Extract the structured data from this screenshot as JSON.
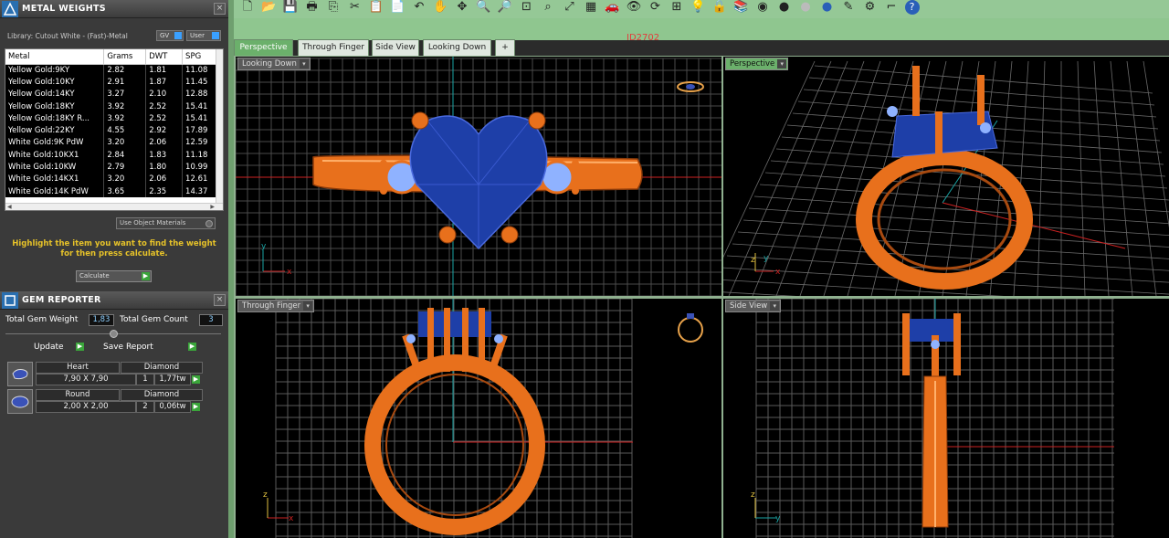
{
  "metal_weights": {
    "title": "METAL WEIGHTS",
    "close": "×",
    "library": "Library: Cutout White - (Fast)-Metal",
    "gv_btn": "GV",
    "user_btn": "User",
    "columns": [
      "Metal",
      "Grams",
      "DWT",
      "SPG"
    ],
    "rows": [
      [
        "Yellow Gold:9KY",
        "2.82",
        "1.81",
        "11.08"
      ],
      [
        "Yellow Gold:10KY",
        "2.91",
        "1.87",
        "11.45"
      ],
      [
        "Yellow Gold:14KY",
        "3.27",
        "2.10",
        "12.88"
      ],
      [
        "Yellow Gold:18KY",
        "3.92",
        "2.52",
        "15.41"
      ],
      [
        "Yellow Gold:18KY R...",
        "3.92",
        "2.52",
        "15.41"
      ],
      [
        "Yellow Gold:22KY",
        "4.55",
        "2.92",
        "17.89"
      ],
      [
        "White Gold:9K PdW",
        "3.20",
        "2.06",
        "12.59"
      ],
      [
        "White Gold:10KX1",
        "2.84",
        "1.83",
        "11.18"
      ],
      [
        "White Gold:10KW",
        "2.79",
        "1.80",
        "10.99"
      ],
      [
        "White Gold:14KX1",
        "3.20",
        "2.06",
        "12.61"
      ],
      [
        "White Gold:14K PdW",
        "3.65",
        "2.35",
        "14.37"
      ]
    ],
    "use_object_materials": "Use Object Materials",
    "highlight_text_1": "Highlight the item you want to find the weight",
    "highlight_text_2": "for then press calculate.",
    "calculate": "Calculate"
  },
  "gem_reporter": {
    "title": "GEM REPORTER",
    "close": "×",
    "total_weight_label": "Total Gem Weight",
    "total_weight_value": "1,83",
    "total_count_label": "Total Gem Count",
    "total_count_value": "3",
    "update": "Update",
    "save_report": "Save Report",
    "gems": [
      {
        "shape": "Heart",
        "size": "7,90 X 7,90",
        "material": "Diamond",
        "count": "1",
        "weight": "1,77tw"
      },
      {
        "shape": "Round",
        "size": "2,00 X 2,00",
        "material": "Diamond",
        "count": "2",
        "weight": "0,06tw"
      }
    ]
  },
  "document_id": "ID2702",
  "tabs": [
    "Perspective",
    "Through Finger",
    "Side View",
    "Looking Down",
    "+"
  ],
  "active_tab": 0,
  "viewports": {
    "top_left": {
      "label": "Looking Down",
      "axis_v": "y",
      "axis_h": "x"
    },
    "top_right": {
      "label": "Perspective",
      "axis_v": "z",
      "axis_h": "x",
      "axis_d": "y"
    },
    "bottom_left": {
      "label": "Through Finger",
      "axis_v": "z",
      "axis_h": "x"
    },
    "bottom_right": {
      "label": "Side View",
      "axis_v": "z",
      "axis_h": "y"
    }
  },
  "colors": {
    "metal": "#e8701c",
    "gem": "#1e3fa8",
    "accent_label": "#e6c229",
    "grid": "#7a7a7a",
    "axis_x": "#cc2222",
    "axis_y": "#1aa3a3",
    "toolbar": "#95c896"
  },
  "toolbar_icons": [
    "new-icon",
    "open-icon",
    "save-icon",
    "print-icon",
    "copy-icon",
    "cut-icon",
    "paste-icon",
    "clipboard-icon",
    "undo-icon",
    "hand-icon",
    "move-icon",
    "zoom-in-icon",
    "zoom-out-icon",
    "zoom-box-icon",
    "zoom-window-icon",
    "zoom-extents-icon",
    "grid-icon",
    "car-icon",
    "eye-icon",
    "rotate-icon",
    "snap-icon",
    "bulb-icon",
    "lock-icon",
    "layers-icon",
    "color-wheel-icon",
    "sphere-dark-icon",
    "sphere-light-icon",
    "sphere-blue-icon",
    "wand-icon",
    "gear-icon",
    "trim-icon",
    "help-icon"
  ]
}
